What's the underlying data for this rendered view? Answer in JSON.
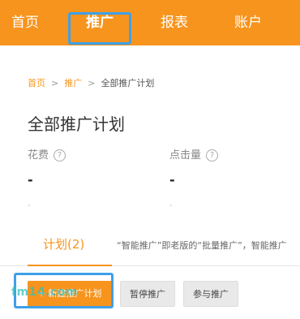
{
  "colors": {
    "accent": "#f7941d",
    "highlight": "#3ea0e8",
    "watermark": "#32bebe"
  },
  "nav": {
    "items": [
      {
        "label": "首页"
      },
      {
        "label": "推广",
        "active": true
      },
      {
        "label": "报表"
      },
      {
        "label": "账户"
      }
    ]
  },
  "breadcrumb": {
    "home": "首页",
    "promotion": "推广",
    "current": "全部推广计划",
    "separator": ">"
  },
  "page": {
    "title": "全部推广计划"
  },
  "stats": {
    "cost": {
      "label": "花费",
      "value": "-",
      "sub": "-"
    },
    "clicks": {
      "label": "点击量",
      "value": "-",
      "sub": "-"
    }
  },
  "tabs": {
    "plan": {
      "label": "计划(2)"
    },
    "description": "“智能推广”即老版的“批量推广”，智能推广"
  },
  "actions": {
    "new_plan": "+ 新建推广计划",
    "pause": "暂停推广",
    "join": "参与推广"
  },
  "icons": {
    "help": "question-circle-icon"
  },
  "watermark": {
    "text": "fm14.com"
  }
}
